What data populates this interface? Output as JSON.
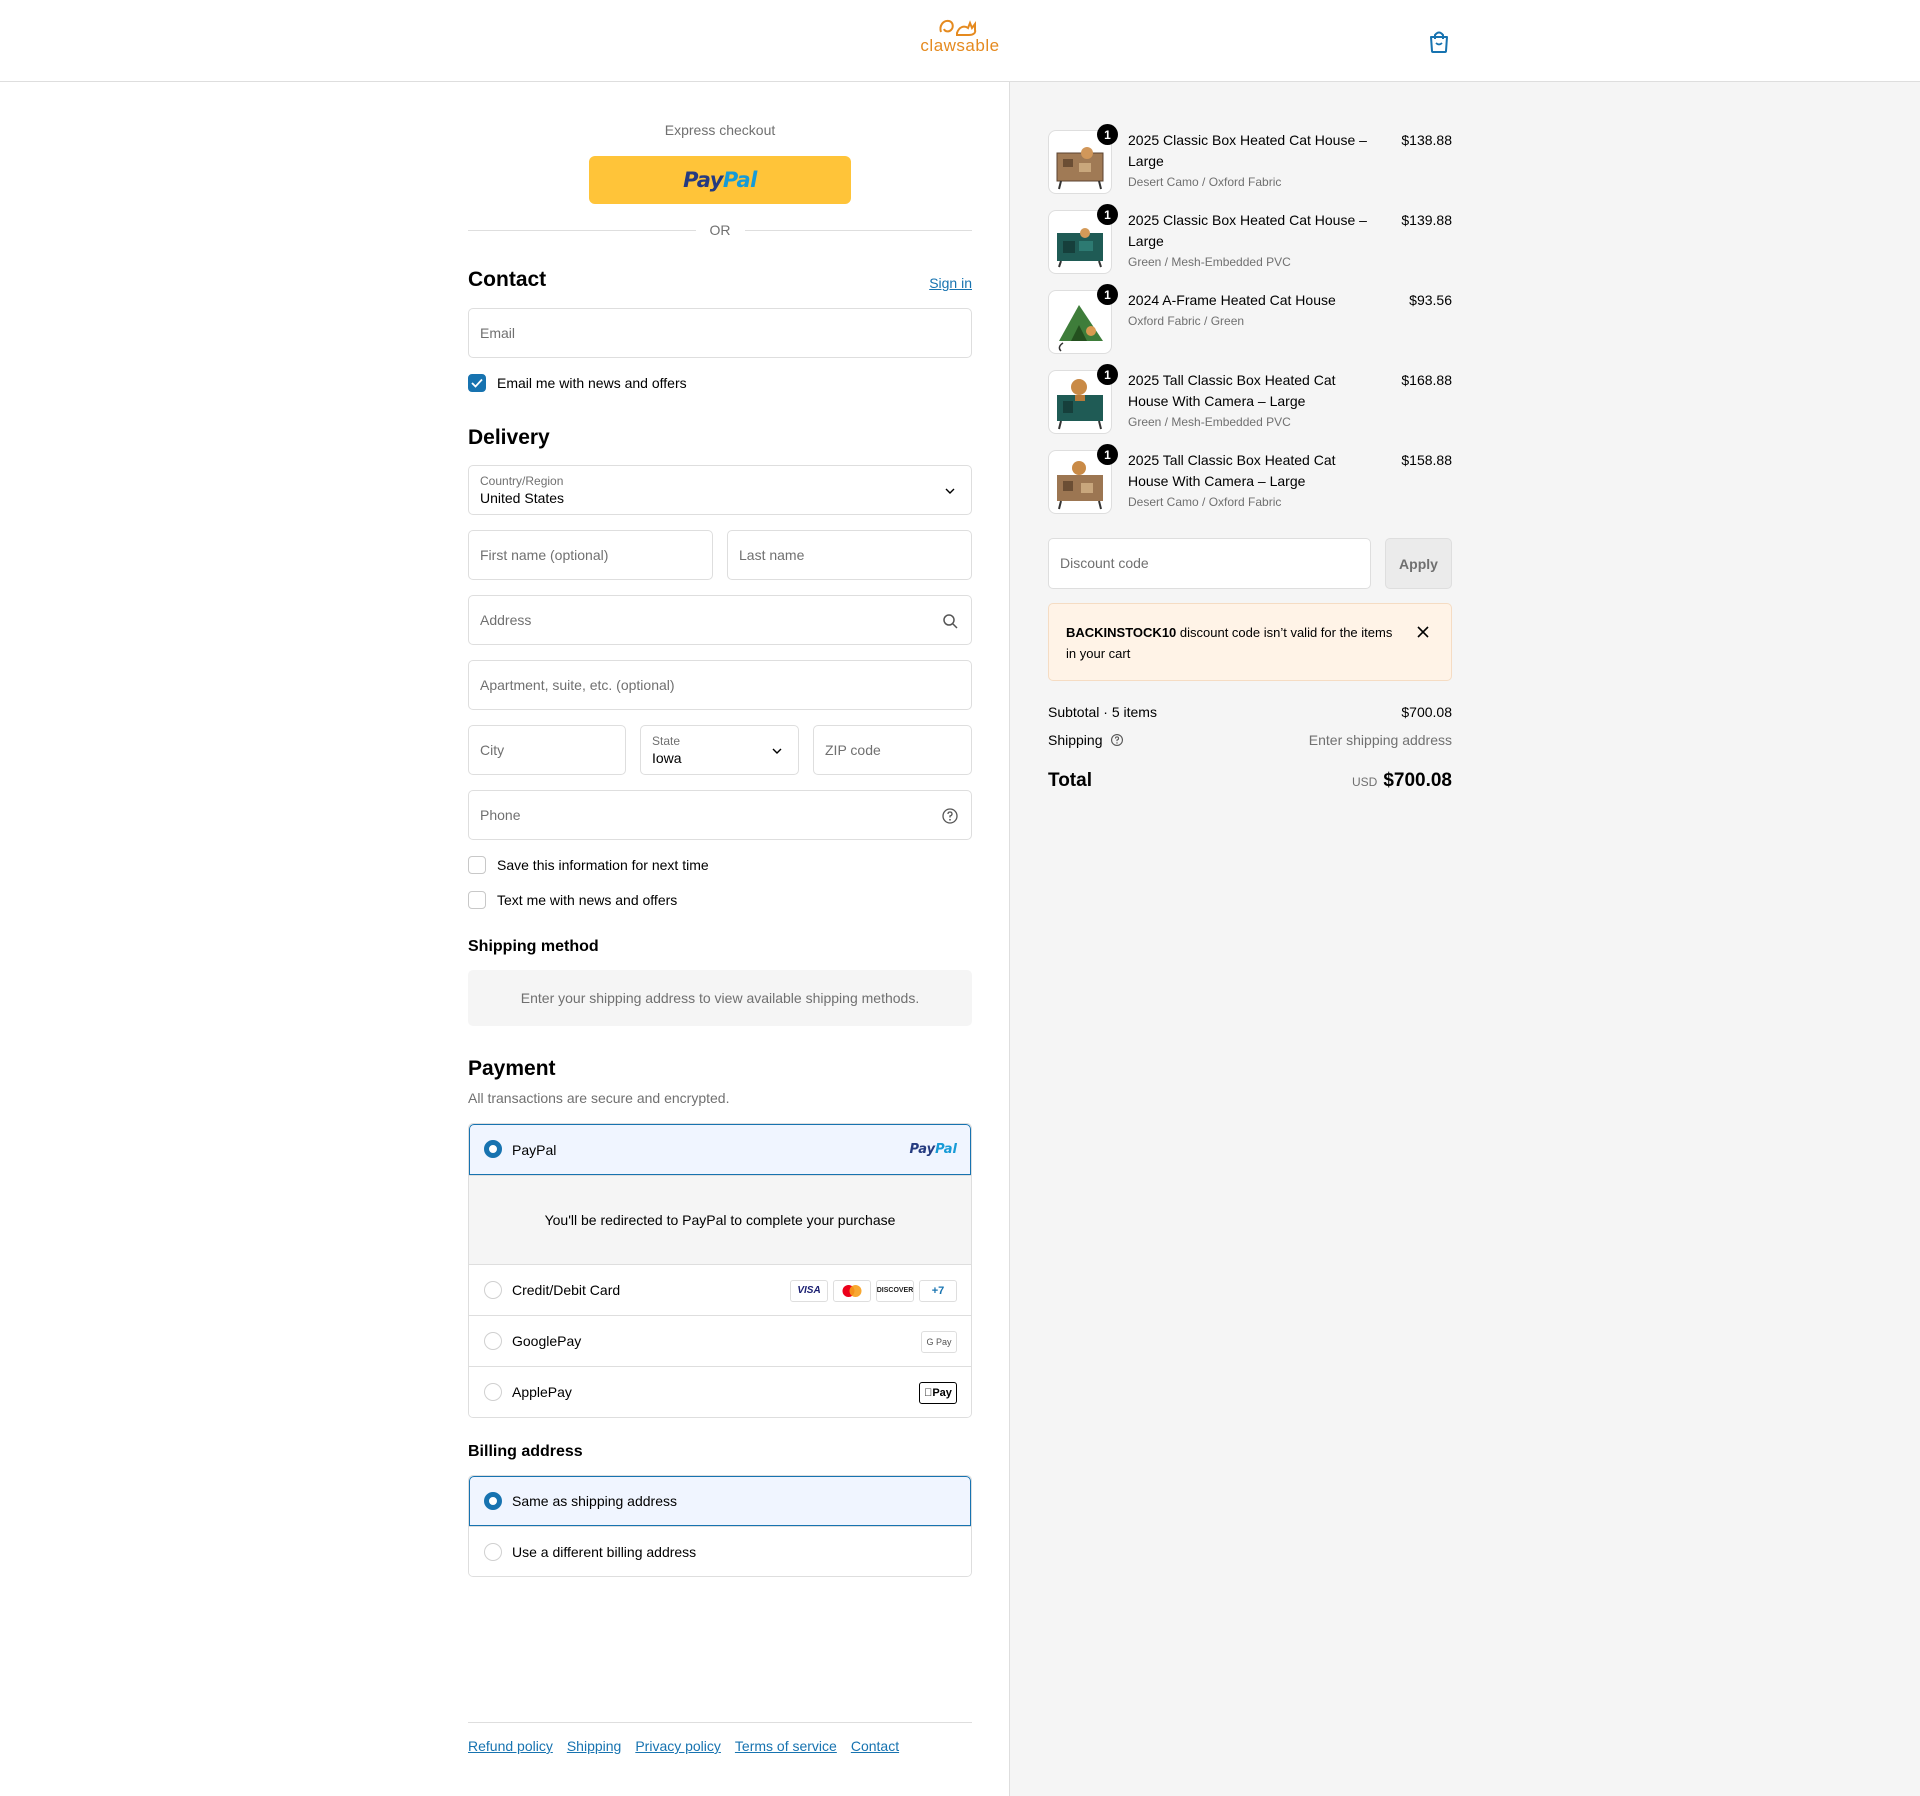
{
  "header": {
    "brand": "clawsable"
  },
  "express": {
    "label": "Express checkout",
    "or": "OR",
    "paypal_a": "Pay",
    "paypal_b": "Pal"
  },
  "contact": {
    "title": "Contact",
    "sign_in": "Sign in",
    "email_placeholder": "Email",
    "news_label": "Email me with news and offers",
    "news_checked": true
  },
  "delivery": {
    "title": "Delivery",
    "country_label": "Country/Region",
    "country_value": "United States",
    "first_name_placeholder": "First name (optional)",
    "last_name_placeholder": "Last name",
    "address_placeholder": "Address",
    "apartment_placeholder": "Apartment, suite, etc. (optional)",
    "city_placeholder": "City",
    "state_label": "State",
    "state_value": "Iowa",
    "zip_placeholder": "ZIP code",
    "phone_placeholder": "Phone",
    "save_info_label": "Save this information for next time",
    "text_me_label": "Text me with news and offers"
  },
  "shipping_method": {
    "title": "Shipping method",
    "note": "Enter your shipping address to view available shipping methods."
  },
  "payment": {
    "title": "Payment",
    "subtitle": "All transactions are secure and encrypted.",
    "options": [
      {
        "label": "PayPal",
        "selected": true
      },
      {
        "label": "Credit/Debit Card",
        "selected": false
      },
      {
        "label": "GooglePay",
        "selected": false
      },
      {
        "label": "ApplePay",
        "selected": false
      }
    ],
    "paypal_logo_a": "Pay",
    "paypal_logo_b": "Pal",
    "redirect_note": "You'll be redirected to PayPal to complete your purchase",
    "cards": [
      "VISA",
      "DISCOVER",
      "+7"
    ],
    "gpay": "G Pay",
    "applepay": "Pay"
  },
  "billing": {
    "title": "Billing address",
    "options": [
      {
        "label": "Same as shipping address",
        "selected": true
      },
      {
        "label": "Use a different billing address",
        "selected": false
      }
    ]
  },
  "footer": {
    "links": [
      "Refund policy",
      "Shipping",
      "Privacy policy",
      "Terms of service",
      "Contact"
    ]
  },
  "summary": {
    "items": [
      {
        "name": "2025 Classic Box Heated Cat House – Large",
        "variant": "Desert Camo / Oxford Fabric",
        "price": "$138.88",
        "qty": "1"
      },
      {
        "name": "2025 Classic Box Heated Cat House – Large",
        "variant": "Green / Mesh-Embedded PVC",
        "price": "$139.88",
        "qty": "1"
      },
      {
        "name": "2024 A-Frame Heated Cat House",
        "variant": "Oxford Fabric / Green",
        "price": "$93.56",
        "qty": "1"
      },
      {
        "name": "2025 Tall Classic Box Heated Cat House With Camera – Large",
        "variant": "Green / Mesh-Embedded PVC",
        "price": "$168.88",
        "qty": "1"
      },
      {
        "name": "2025 Tall Classic Box Heated Cat House With Camera – Large",
        "variant": "Desert Camo / Oxford Fabric",
        "price": "$158.88",
        "qty": "1"
      }
    ],
    "discount_placeholder": "Discount code",
    "apply_label": "Apply",
    "error_code": "BACKINSTOCK10",
    "error_text": " discount code isn’t valid for the items in your cart",
    "subtotal_label": "Subtotal · 5 items",
    "subtotal_value": "$700.08",
    "shipping_label": "Shipping",
    "shipping_value": "Enter shipping address",
    "total_label": "Total",
    "total_currency": "USD",
    "total_value": "$700.08"
  },
  "colors": {
    "accent": "#1773b0",
    "paypal_yellow": "#ffc439",
    "brand_orange": "#e58a1f",
    "error_bg": "#fff3e7"
  }
}
